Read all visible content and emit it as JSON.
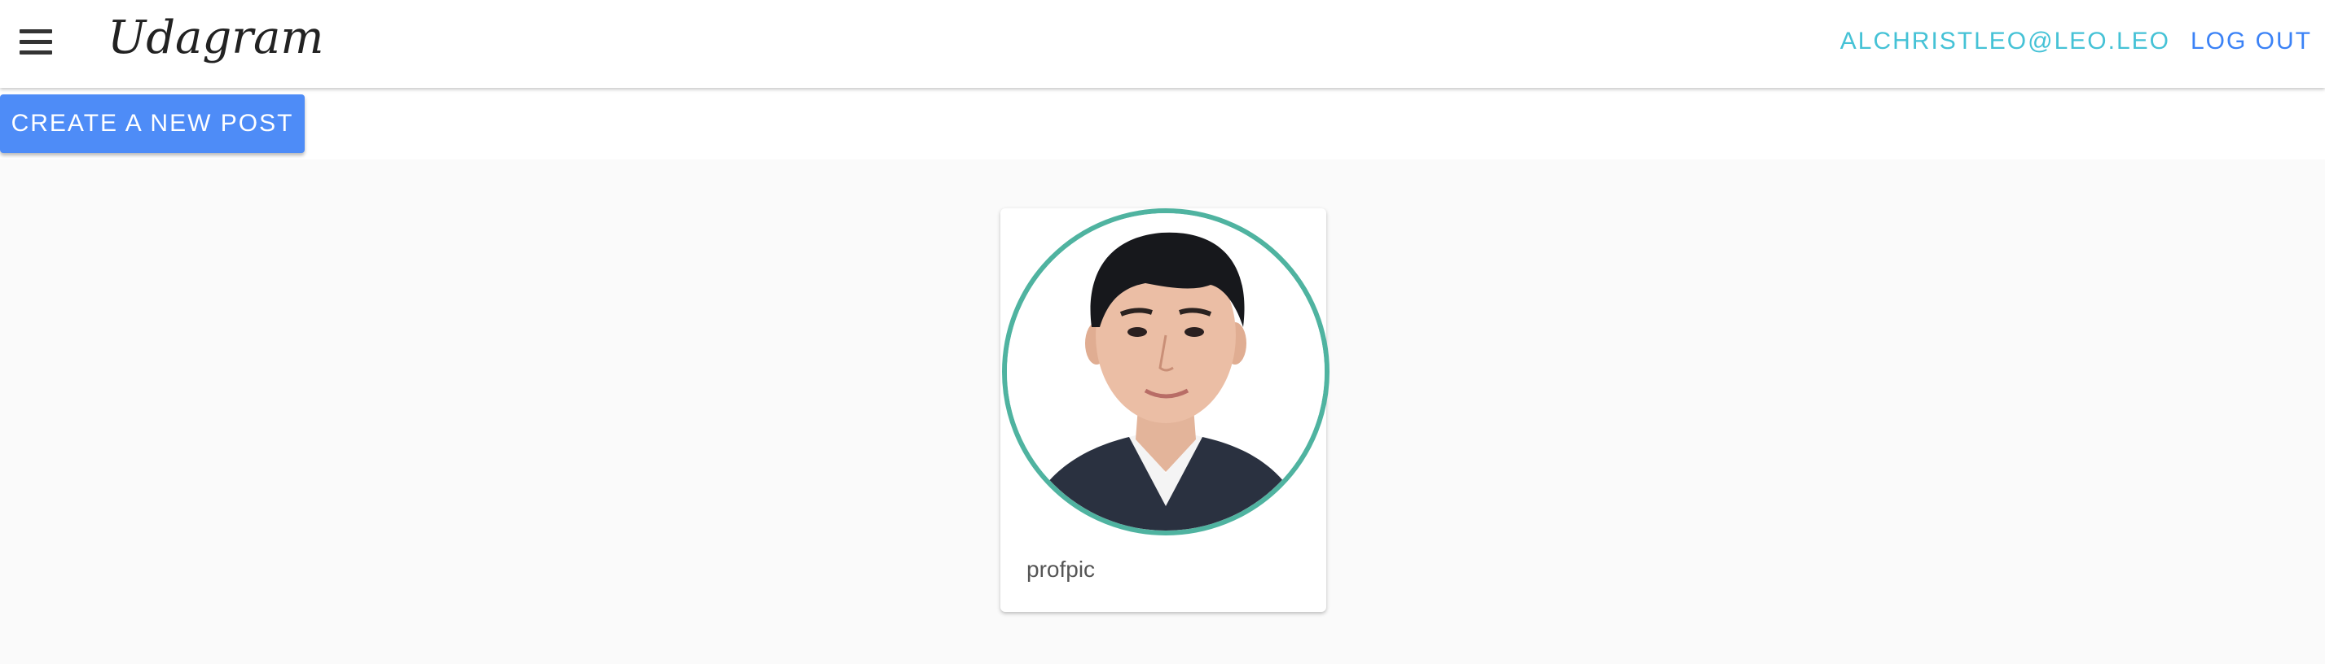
{
  "header": {
    "menu_icon": "hamburger-menu-icon",
    "brand": "Udagram",
    "user_email": "ALCHRISTLEO@LEO.LEO",
    "logout_label": "LOG OUT"
  },
  "actions": {
    "create_post_label": "CREATE A NEW POST"
  },
  "feed": {
    "items": [
      {
        "caption": "profpic",
        "image": "profile-photo"
      }
    ]
  },
  "colors": {
    "primary_button": "#4e8cf7",
    "user_link": "#45c2d6",
    "logout_link": "#3b82f6",
    "avatar_border": "#4fb3a0",
    "background": "#fafafa"
  }
}
